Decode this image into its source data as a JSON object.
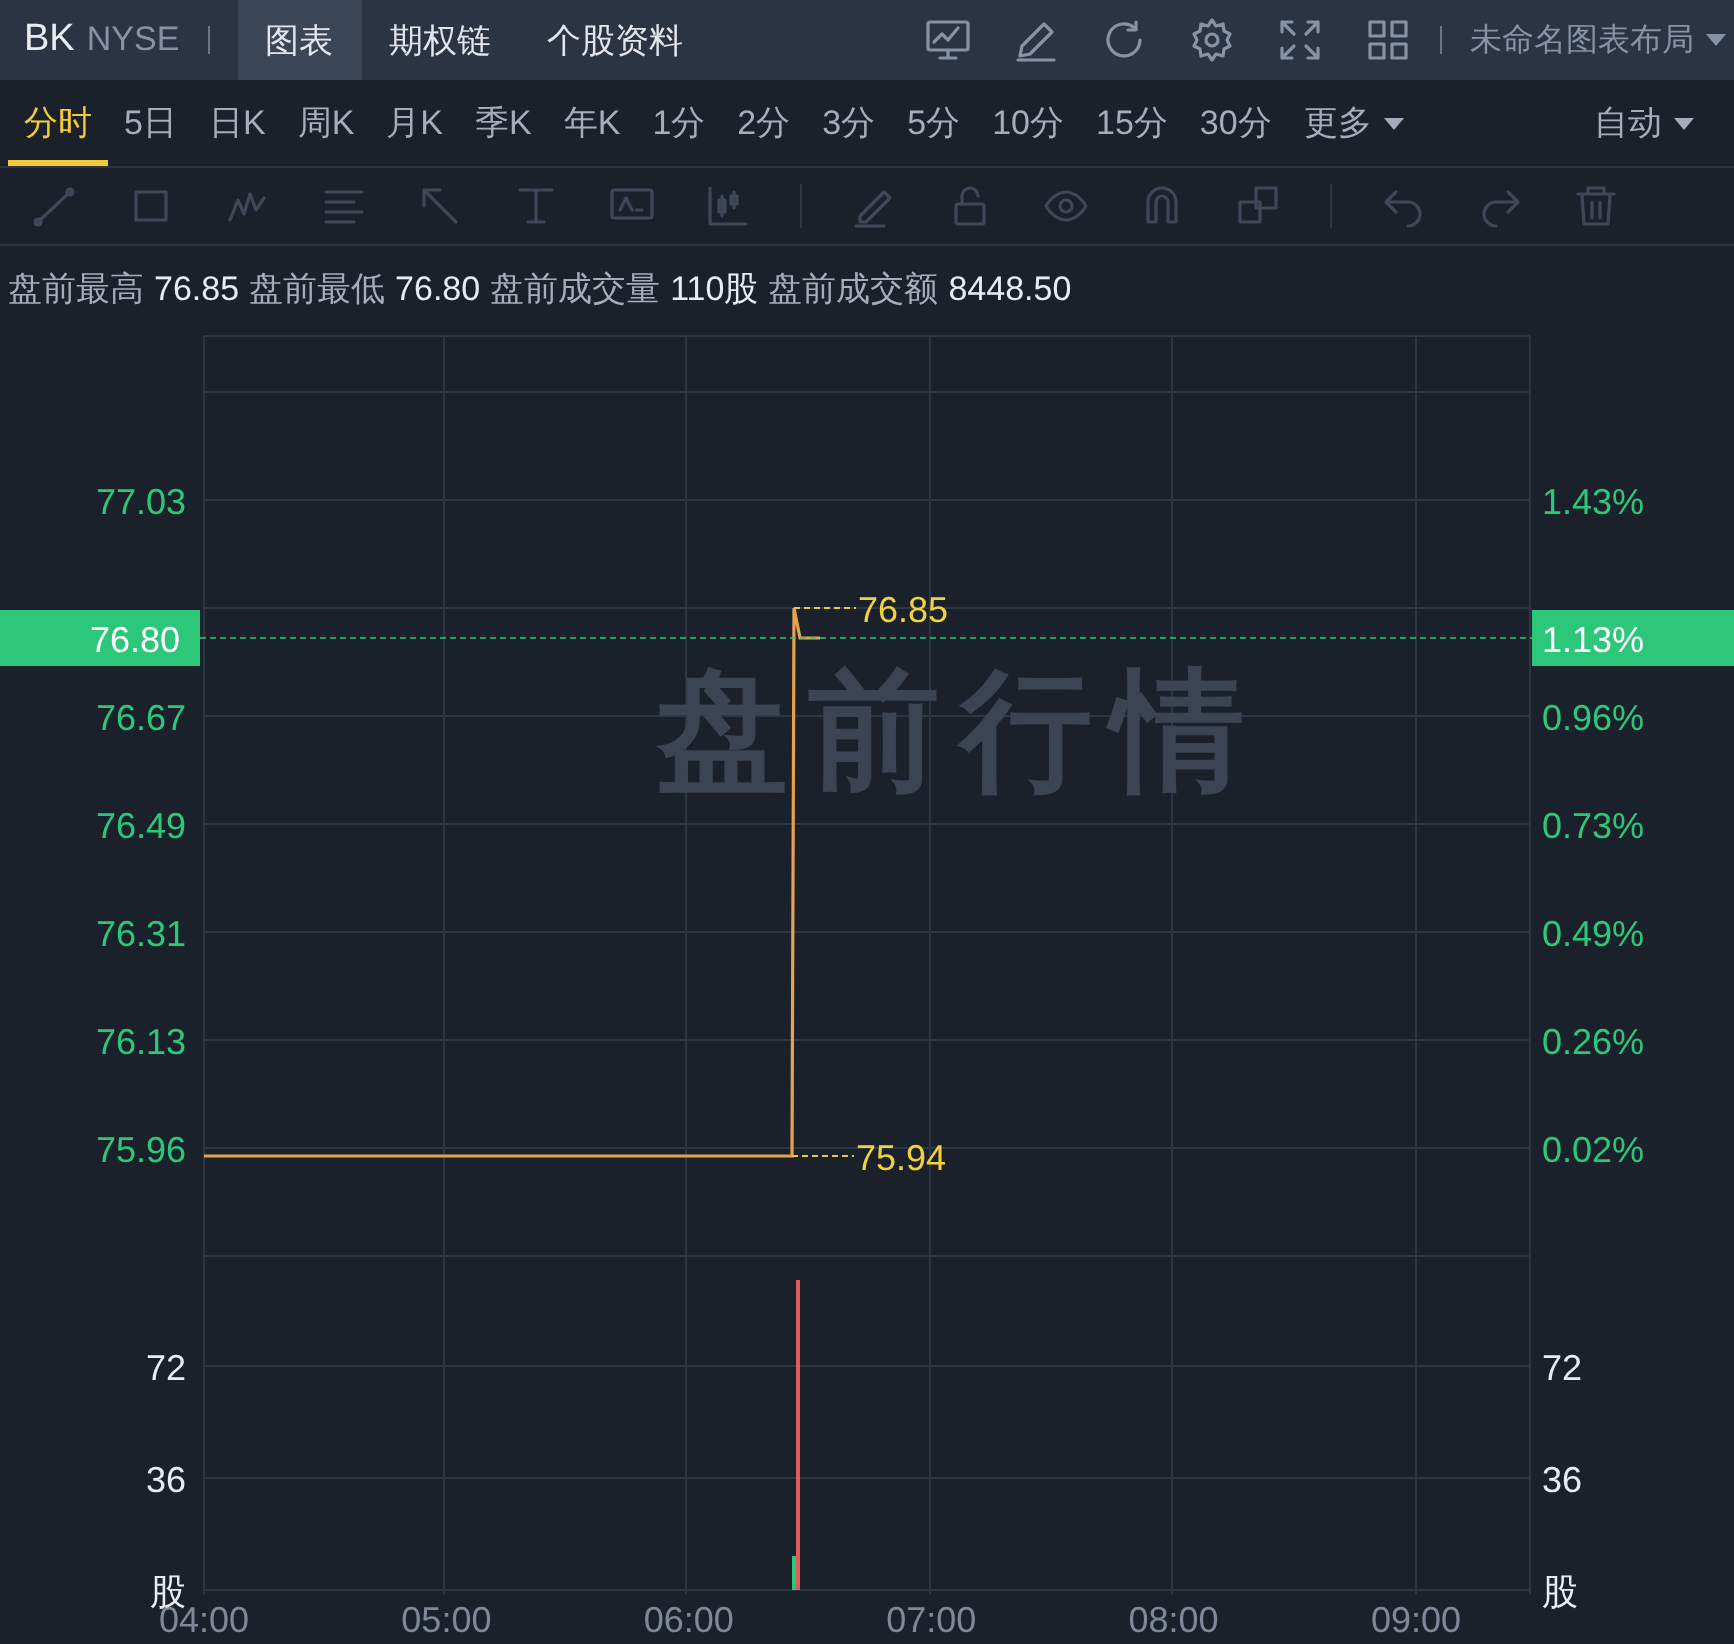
{
  "header": {
    "symbol": "BK",
    "exchange": "NYSE",
    "tabs": [
      {
        "label": "图表",
        "selected": true
      },
      {
        "label": "期权链",
        "selected": false
      },
      {
        "label": "个股资料",
        "selected": false
      }
    ],
    "layout_menu": "未命名图表布局"
  },
  "periods": [
    {
      "label": "分时",
      "selected": true
    },
    {
      "label": "5日",
      "selected": false
    },
    {
      "label": "日K",
      "selected": false
    },
    {
      "label": "周K",
      "selected": false
    },
    {
      "label": "月K",
      "selected": false
    },
    {
      "label": "季K",
      "selected": false
    },
    {
      "label": "年K",
      "selected": false
    },
    {
      "label": "1分",
      "selected": false
    },
    {
      "label": "2分",
      "selected": false
    },
    {
      "label": "3分",
      "selected": false
    },
    {
      "label": "5分",
      "selected": false
    },
    {
      "label": "10分",
      "selected": false
    },
    {
      "label": "15分",
      "selected": false
    },
    {
      "label": "30分",
      "selected": false
    }
  ],
  "more_menu": "更多",
  "scale_menu": "自动",
  "stats": [
    {
      "label": "盘前最高",
      "value": "76.85"
    },
    {
      "label": "盘前最低",
      "value": "76.80"
    },
    {
      "label": "盘前成交量",
      "value": "110股"
    },
    {
      "label": "盘前成交额",
      "value": "8448.50"
    }
  ],
  "price_chart": {
    "watermark": "盘前行情",
    "price_badge": "76.80",
    "percent_badge": "1.13%",
    "left_axis_labels": [
      "77.03",
      "76.67",
      "76.49",
      "76.31",
      "76.13",
      "75.96"
    ],
    "right_axis_labels": [
      "1.43%",
      "0.96%",
      "0.73%",
      "0.49%",
      "0.26%",
      "0.02%"
    ],
    "high_label": "76.85",
    "low_label": "75.94"
  },
  "volume_chart": {
    "left_axis_labels": [
      "72",
      "36",
      "股"
    ],
    "right_axis_labels": [
      "72",
      "36",
      "股"
    ]
  },
  "time_axis_labels": [
    "04:00",
    "05:00",
    "06:00",
    "07:00",
    "08:00",
    "09:00"
  ]
}
